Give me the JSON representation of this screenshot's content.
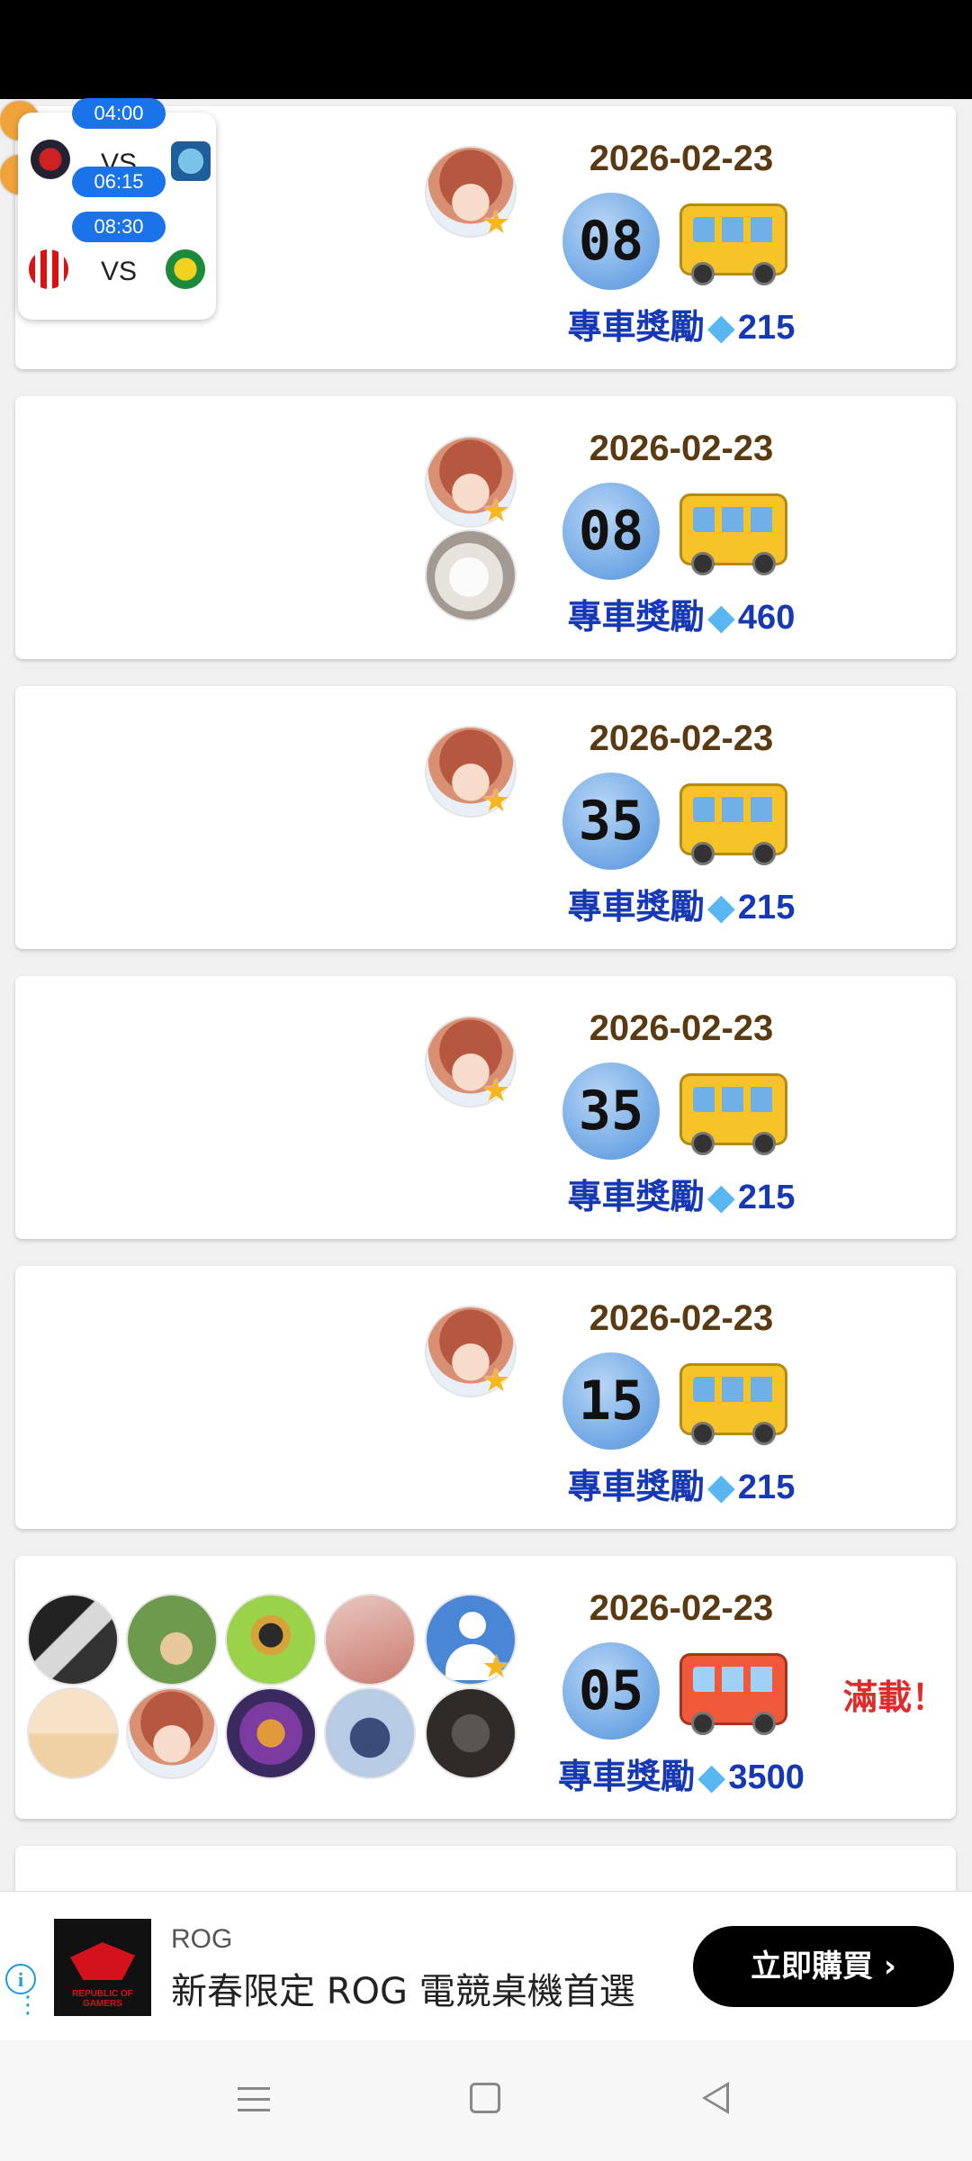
{
  "colors": {
    "date": "#5a3a12",
    "reward": "#1638b5",
    "full": "#e02b2b",
    "badge": "#1a73e8"
  },
  "posts": [
    {
      "date": "2026-02-23",
      "number": "08",
      "reward_label": "專車獎勵",
      "reward_icon": "diamond-icon",
      "reward_value": "215",
      "bus": "yellow-bus-icon",
      "avatars": [
        "anime-girl-avatar"
      ]
    },
    {
      "date": "2026-02-23",
      "number": "08",
      "reward_label": "專車獎勵",
      "reward_icon": "diamond-icon",
      "reward_value": "460",
      "bus": "yellow-bus-icon",
      "avatars": [
        "anime-girl-avatar",
        "white-dog-avatar"
      ]
    },
    {
      "date": "2026-02-23",
      "number": "35",
      "reward_label": "專車獎勵",
      "reward_icon": "diamond-icon",
      "reward_value": "215",
      "bus": "yellow-bus-icon",
      "avatars": [
        "anime-girl-avatar"
      ]
    },
    {
      "date": "2026-02-23",
      "number": "35",
      "reward_label": "專車獎勵",
      "reward_icon": "diamond-icon",
      "reward_value": "215",
      "bus": "yellow-bus-icon",
      "avatars": [
        "anime-girl-avatar"
      ]
    },
    {
      "date": "2026-02-23",
      "number": "15",
      "reward_label": "專車獎勵",
      "reward_icon": "diamond-icon",
      "reward_value": "215",
      "bus": "yellow-bus-icon",
      "avatars": [
        "anime-girl-avatar"
      ]
    },
    {
      "date": "2026-02-23",
      "number": "05",
      "reward_label": "專車獎勵",
      "reward_icon": "diamond-icon",
      "reward_value": "3500",
      "bus": "red-bus-icon",
      "full_label": "滿載！",
      "avatars": [
        "user-avatar-1",
        "user-avatar-2",
        "user-avatar-3",
        "user-avatar-4",
        "default-user-avatar",
        "user-avatar-5",
        "anime-girl-avatar",
        "user-avatar-6",
        "user-avatar-7",
        "user-avatar-8"
      ]
    }
  ],
  "match_widget": {
    "matches": [
      {
        "time": "04:00",
        "vs": "VS"
      },
      {
        "time": "06:15"
      },
      {
        "time": "08:30",
        "vs": "VS"
      }
    ]
  },
  "ad": {
    "brand": "ROG",
    "logo_tag": "REPUBLIC OF GAMERS",
    "title": "新春限定 ROG 電競桌機首選",
    "button": "立即購買",
    "info_icon": "info-icon"
  },
  "navbar": {
    "items": [
      "menu-icon",
      "home-icon",
      "back-icon"
    ]
  }
}
